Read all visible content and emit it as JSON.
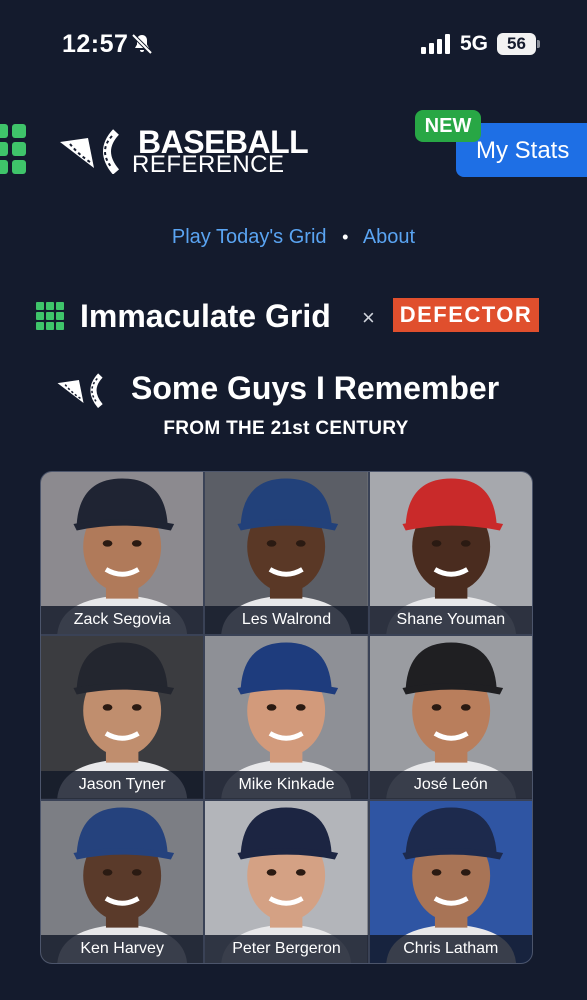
{
  "status_bar": {
    "time": "12:57",
    "network": "5G",
    "battery_level": "56",
    "silent_icon": "bell-slash-icon",
    "signal_icon": "cellular-signal-icon"
  },
  "header": {
    "logo_line1": "BASEBALL",
    "logo_line2": "REFERENCE",
    "new_badge": "NEW",
    "my_stats_label": "My Stats",
    "menu_icon": "grid-menu-icon"
  },
  "nav": {
    "play_today": "Play Today's Grid",
    "separator": "•",
    "about": "About"
  },
  "brand": {
    "title": "Immaculate Grid",
    "times": "×",
    "partner": "DEFECTOR"
  },
  "puzzle": {
    "title": "Some Guys I Remember",
    "subtitle": "FROM THE 21st CENTURY"
  },
  "players": [
    {
      "name": "Zack Segovia",
      "skin": "#b07a5a",
      "cap": "#1f2433",
      "bg": "#8c8a8f"
    },
    {
      "name": "Les Walrond",
      "skin": "#5a3826",
      "cap": "#22417a",
      "bg": "#5b5e66"
    },
    {
      "name": "Shane Youman",
      "skin": "#4a2c1f",
      "cap": "#c92a2a",
      "bg": "#a6a8ad"
    },
    {
      "name": "Jason Tyner",
      "skin": "#c08e6e",
      "cap": "#23262f",
      "bg": "#3b3c40"
    },
    {
      "name": "Mike Kinkade",
      "skin": "#d29a7b",
      "cap": "#1e3c7d",
      "bg": "#8e9096"
    },
    {
      "name": "José León",
      "skin": "#b97e5c",
      "cap": "#1f1f22",
      "bg": "#9a9ca1"
    },
    {
      "name": "Ken Harvey",
      "skin": "#5a3a2a",
      "cap": "#25427d",
      "bg": "#7c7e84"
    },
    {
      "name": "Peter Bergeron",
      "skin": "#d4a184",
      "cap": "#1c2542",
      "bg": "#b3b5ba"
    },
    {
      "name": "Chris Latham",
      "skin": "#a87456",
      "cap": "#1d2a4d",
      "bg": "#2f55a3"
    }
  ]
}
